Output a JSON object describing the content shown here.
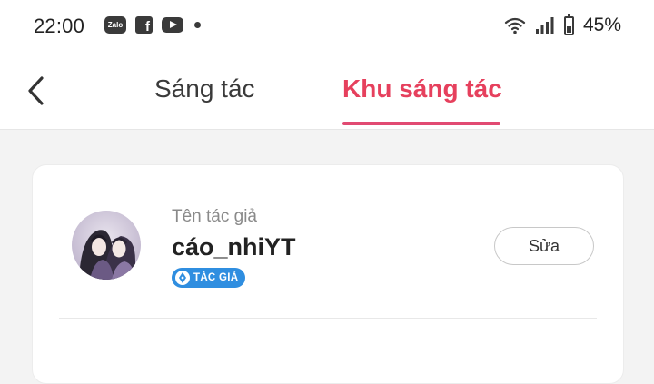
{
  "status_bar": {
    "time": "22:00",
    "notification_icons": [
      "zalo-icon",
      "facebook-icon",
      "youtube-icon",
      "dot-icon"
    ],
    "zalo_label": "Zalo",
    "facebook_glyph": "f",
    "battery_percent": "45%",
    "battery_level": 0.45
  },
  "nav": {
    "back_icon": "chevron-left-icon",
    "tabs": [
      {
        "label": "Sáng tác",
        "active": false
      },
      {
        "label": "Khu sáng tác",
        "active": true
      }
    ],
    "active_color": "#e6405d"
  },
  "author_card": {
    "label": "Tên tác giả",
    "name": "cáo_nhiYT",
    "badge": "TÁC GIẢ",
    "badge_color": "#2f8ee0",
    "edit_button": "Sửa"
  }
}
